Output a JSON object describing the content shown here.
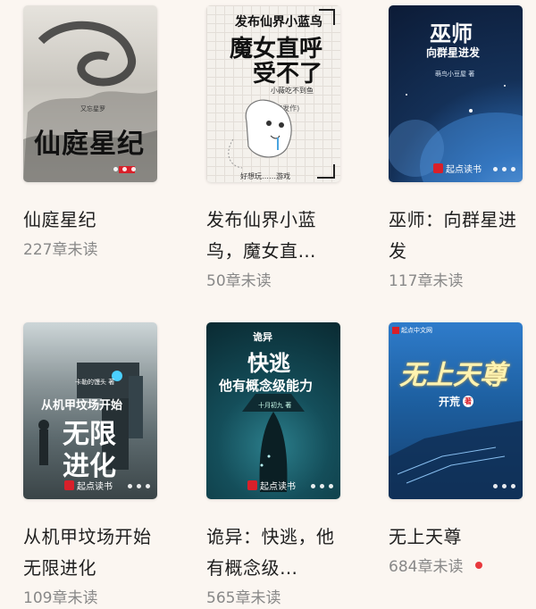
{
  "books": [
    {
      "title": "仙庭星纪",
      "unread": "227章未读",
      "cover_title": "仙庭星纪",
      "cover_author": "又忘星罗",
      "badge": "起点",
      "colors": {
        "bg": "#d9d6cf"
      }
    },
    {
      "title": "发布仙界小蓝鸟，魔女直…",
      "unread": "50章未读",
      "cover_line1": "发布仙界小蓝鸟",
      "cover_line2": "魔女直呼",
      "cover_line3": "受不了",
      "cover_small": "小薇吃不到鱼",
      "cover_tag": "(毒瘾发作)",
      "cover_bottom": "好想玩……游戏",
      "colors": {
        "bg": "#f3f0ec"
      }
    },
    {
      "title": "巫师：向群星进发",
      "unread": "117章未读",
      "cover_title": "巫师",
      "cover_sub": "向群星进发",
      "cover_author": "萌鸟小豆屋 著",
      "badge": "起点读书",
      "colors": {
        "bg": "#1b3a6b"
      }
    },
    {
      "title": "从机甲坟场开始无限进化",
      "unread": "109章未读",
      "cover_author": "卡勒的馒头 著",
      "cover_line1": "从机甲坟场开始",
      "cover_line2": "无限",
      "cover_line3": "进化",
      "badge": "起点读书",
      "colors": {
        "bg": "#5d6a6e"
      }
    },
    {
      "title": "诡异：快逃，他有概念级…",
      "unread": "565章未读",
      "cover_tag": "诡异",
      "cover_line1": "快逃",
      "cover_line2": "他有概念级能力",
      "cover_author": "十月初九 著",
      "badge": "起点读书",
      "colors": {
        "bg": "#0e3a44"
      }
    },
    {
      "title": "无上天尊",
      "unread": "684章未读",
      "cover_title": "无上天尊",
      "cover_author": "开荒",
      "cover_author_mark": "著",
      "badge": "起点中文网",
      "colors": {
        "bg": "#1d5fa0"
      },
      "has_update_dot": true
    }
  ],
  "colors": {
    "accent_red": "#e8383d",
    "text_gray": "#888888",
    "background": "#fbf6f1"
  }
}
